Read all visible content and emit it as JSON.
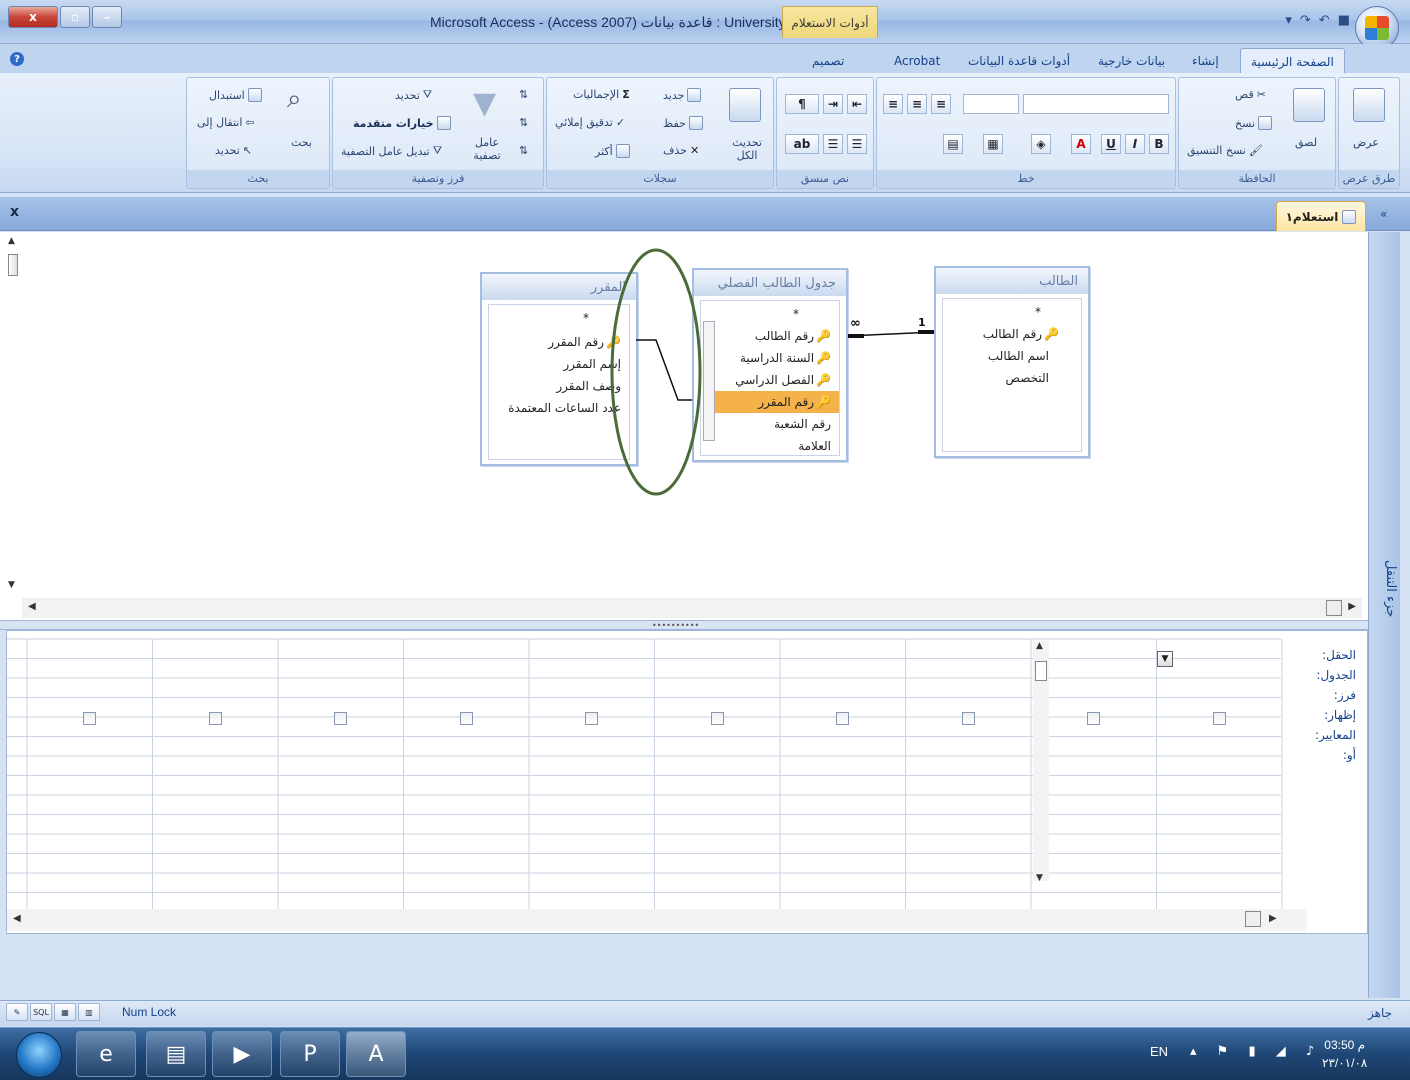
{
  "window": {
    "title": "Microsoft Access - (Access 2007) قاعدة بيانات : University",
    "context_tab": "أدوات الاستعلام"
  },
  "ribbon_tabs": [
    {
      "label": "الصفحة الرئيسية",
      "active": true
    },
    {
      "label": "إنشاء"
    },
    {
      "label": "بيانات خارجية"
    },
    {
      "label": "أدوات قاعدة البيانات"
    },
    {
      "label": "Acrobat"
    },
    {
      "label": "تصميم"
    }
  ],
  "ribbon": {
    "views": {
      "label": "طرق عرض",
      "button": "عرض"
    },
    "clipboard": {
      "label": "الحافظة",
      "paste": "لصق",
      "cut": "قص",
      "copy": "نسخ",
      "format_painter": "نسخ التنسيق"
    },
    "font": {
      "label": "خط",
      "bold": "B",
      "italic": "I",
      "underline": "U",
      "font_color": "A"
    },
    "rich_text": {
      "label": "نص منسق"
    },
    "records": {
      "label": "سجلات",
      "refresh": "تحديث الكل",
      "new": "جديد",
      "save": "حفظ",
      "delete": "حذف",
      "totals": "الإجماليات",
      "spelling": "تدقيق إملائي",
      "more": "أكثر"
    },
    "sort_filter": {
      "label": "فرز وتصفية",
      "filter": "عامل تصفية",
      "selection": "تحديد",
      "advanced": "خيارات متقدمة",
      "toggle_filter": "تبديل عامل التصفية"
    },
    "find": {
      "label": "بحث",
      "find": "بحث",
      "replace": "استبدال",
      "goto": "انتقال إلى",
      "select": "تحديد"
    }
  },
  "document": {
    "tab_label": "استعلام١",
    "close": "x",
    "nav_pane": "جزء التنقل",
    "collapse": "«"
  },
  "tables": {
    "course": {
      "title": "المقرر",
      "fields": [
        "*",
        "رقم المقرر",
        "إسم المقرر",
        "وصف المقرر",
        "عدد الساعات المعتمدة"
      ],
      "keys": [
        1
      ]
    },
    "enrollment": {
      "title": "جدول الطالب الفصلي",
      "fields": [
        "*",
        "رقم الطالب",
        "السنة الدراسية",
        "الفصل الدراسي",
        "رقم المقرر",
        "رقم الشعبة",
        "العلامة"
      ],
      "keys": [
        1,
        2,
        3,
        4
      ],
      "selected": 4
    },
    "student": {
      "title": "الطالب",
      "fields": [
        "*",
        "رقم الطالب",
        "اسم الطالب",
        "التخصص"
      ],
      "keys": [
        1
      ]
    }
  },
  "relationship": {
    "one": "1",
    "many": "∞"
  },
  "grid": {
    "row_labels": [
      "الحقل:",
      "الجدول:",
      "فرز:",
      "إظهار:",
      "المعايير:",
      "أو:"
    ],
    "columns": 10
  },
  "status": {
    "ready": "جاهز",
    "num_lock": "Num Lock",
    "views": [
      "SQL"
    ]
  },
  "taskbar": {
    "lang": "EN",
    "time": "03:50 م",
    "date": "٢٣/٠١/٠٨"
  },
  "colors": {
    "accent": "#15428b",
    "highlight": "#f6b24a",
    "annotation": "#4a6b3a"
  }
}
